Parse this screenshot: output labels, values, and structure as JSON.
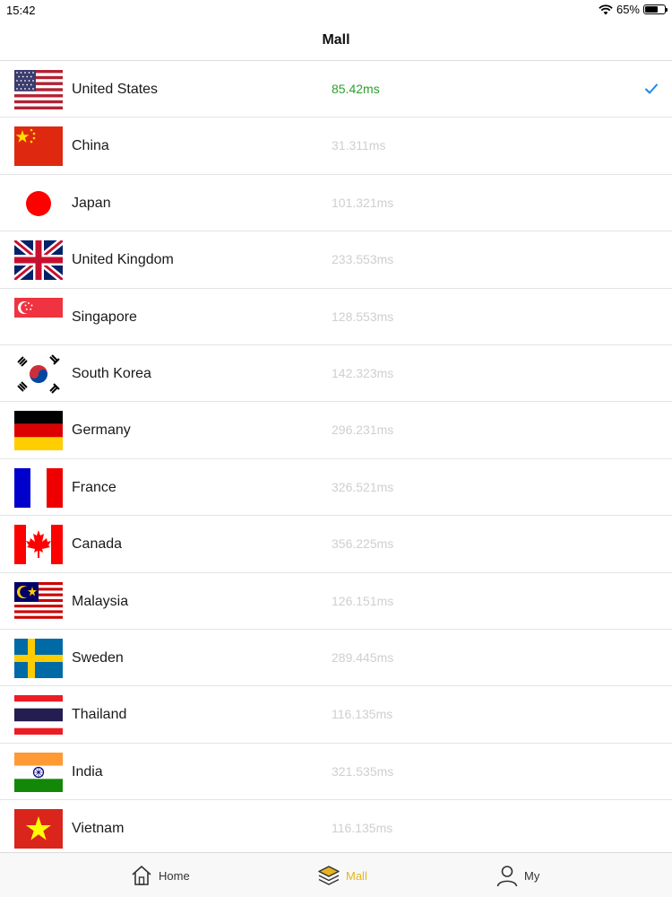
{
  "status": {
    "time": "15:42",
    "battery": "65%",
    "battery_level": 0.65
  },
  "nav": {
    "title": "Mall"
  },
  "colors": {
    "active_latency": "#2ca02c",
    "inactive_latency": "#cfcfcf",
    "check": "#1e88e5",
    "tab_active": "#e6b422"
  },
  "servers": [
    {
      "country": "United States",
      "latency": "85.42ms",
      "flag": "us-flag-icon",
      "selected": true
    },
    {
      "country": "China",
      "latency": "31.311ms",
      "flag": "cn-flag-icon"
    },
    {
      "country": "Japan",
      "latency": "101.321ms",
      "flag": "jp-flag-icon"
    },
    {
      "country": "United Kingdom",
      "latency": "233.553ms",
      "flag": "gb-flag-icon"
    },
    {
      "country": "Singapore",
      "latency": "128.553ms",
      "flag": "sg-flag-icon"
    },
    {
      "country": "South Korea",
      "latency": "142.323ms",
      "flag": "kr-flag-icon"
    },
    {
      "country": "Germany",
      "latency": "296.231ms",
      "flag": "de-flag-icon"
    },
    {
      "country": "France",
      "latency": "326.521ms",
      "flag": "fr-flag-icon"
    },
    {
      "country": "Canada",
      "latency": "356.225ms",
      "flag": "ca-flag-icon"
    },
    {
      "country": "Malaysia",
      "latency": "126.151ms",
      "flag": "my-flag-icon"
    },
    {
      "country": "Sweden",
      "latency": "289.445ms",
      "flag": "se-flag-icon"
    },
    {
      "country": "Thailand",
      "latency": "116.135ms",
      "flag": "th-flag-icon"
    },
    {
      "country": "India",
      "latency": "321.535ms",
      "flag": "in-flag-icon"
    },
    {
      "country": "Vietnam",
      "latency": "116.135ms",
      "flag": "vn-flag-icon"
    }
  ],
  "tabs": [
    {
      "label": "Home",
      "icon": "home-icon"
    },
    {
      "label": "Mall",
      "icon": "layers-icon",
      "active": true
    },
    {
      "label": "My",
      "icon": "user-icon"
    }
  ]
}
